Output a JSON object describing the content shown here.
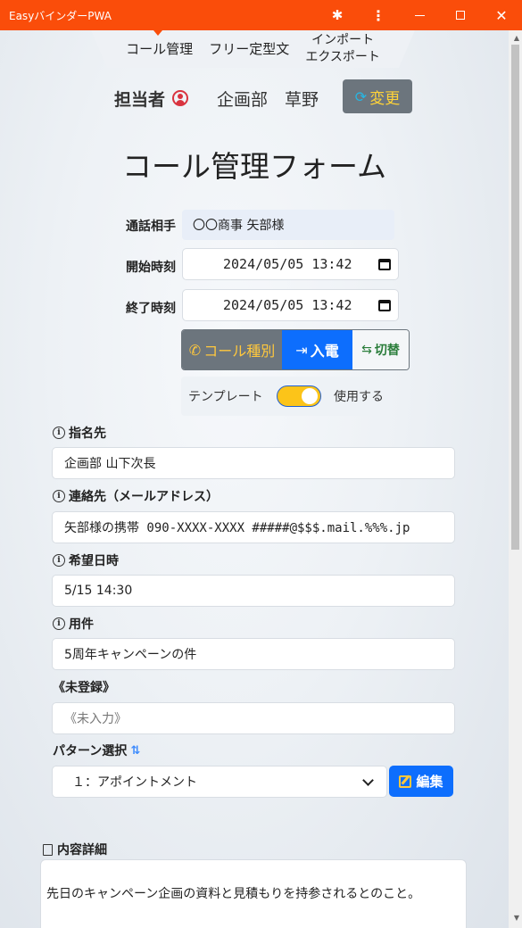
{
  "window": {
    "title": "EasyバインダーPWA",
    "controls": [
      "puzzle-icon",
      "menu-dots-icon",
      "minimize-icon",
      "maximize-icon",
      "close-icon"
    ]
  },
  "nav": {
    "tabs": [
      {
        "label": "コール管理",
        "active": true
      },
      {
        "label": "フリー定型文",
        "active": false
      },
      {
        "label_line1": "インポート",
        "label_line2": "エクスポート",
        "active": false
      }
    ]
  },
  "header": {
    "person_label": "担当者",
    "person_name": "企画部　草野",
    "change_button": "変更"
  },
  "form": {
    "title": "コール管理フォーム",
    "partner_label": "通話相手",
    "partner_value": "〇〇商事 矢部様",
    "start_label": "開始時刻",
    "start_value": "2024/05/05 13:42",
    "end_label": "終了時刻",
    "end_value": "2024/05/05 13:42",
    "call_type_button": "コール種別",
    "call_in_button": "入電",
    "switch_button": "切替",
    "template_label": "テンプレート",
    "template_toggle": "使用する",
    "template_enabled": true,
    "fields": [
      {
        "label": "指名先",
        "value": "企画部 山下次長"
      },
      {
        "label": "連絡先（メールアドレス）",
        "value": "矢部様の携帯 090-XXXX-XXXX #####@$$$.mail.%%%.jp"
      },
      {
        "label": "希望日時",
        "value": "5/15 14:30"
      },
      {
        "label": "用件",
        "value": "5周年キャンペーンの件"
      }
    ],
    "unregistered_label": "《未登録》",
    "unregistered_placeholder": "《未入力》",
    "pattern_label": "パターン選択",
    "pattern_selected": "１：アポイントメント",
    "edit_button": "編集",
    "detail_label": "内容詳細",
    "detail_value": "先日のキャンペーン企画の資料と見積もりを持参されるとのこと。"
  },
  "colors": {
    "titlebar": "#fa4d0a",
    "primary": "#0d6efd",
    "secondary": "#6c757d",
    "accent_yellow": "#ffc83d"
  }
}
